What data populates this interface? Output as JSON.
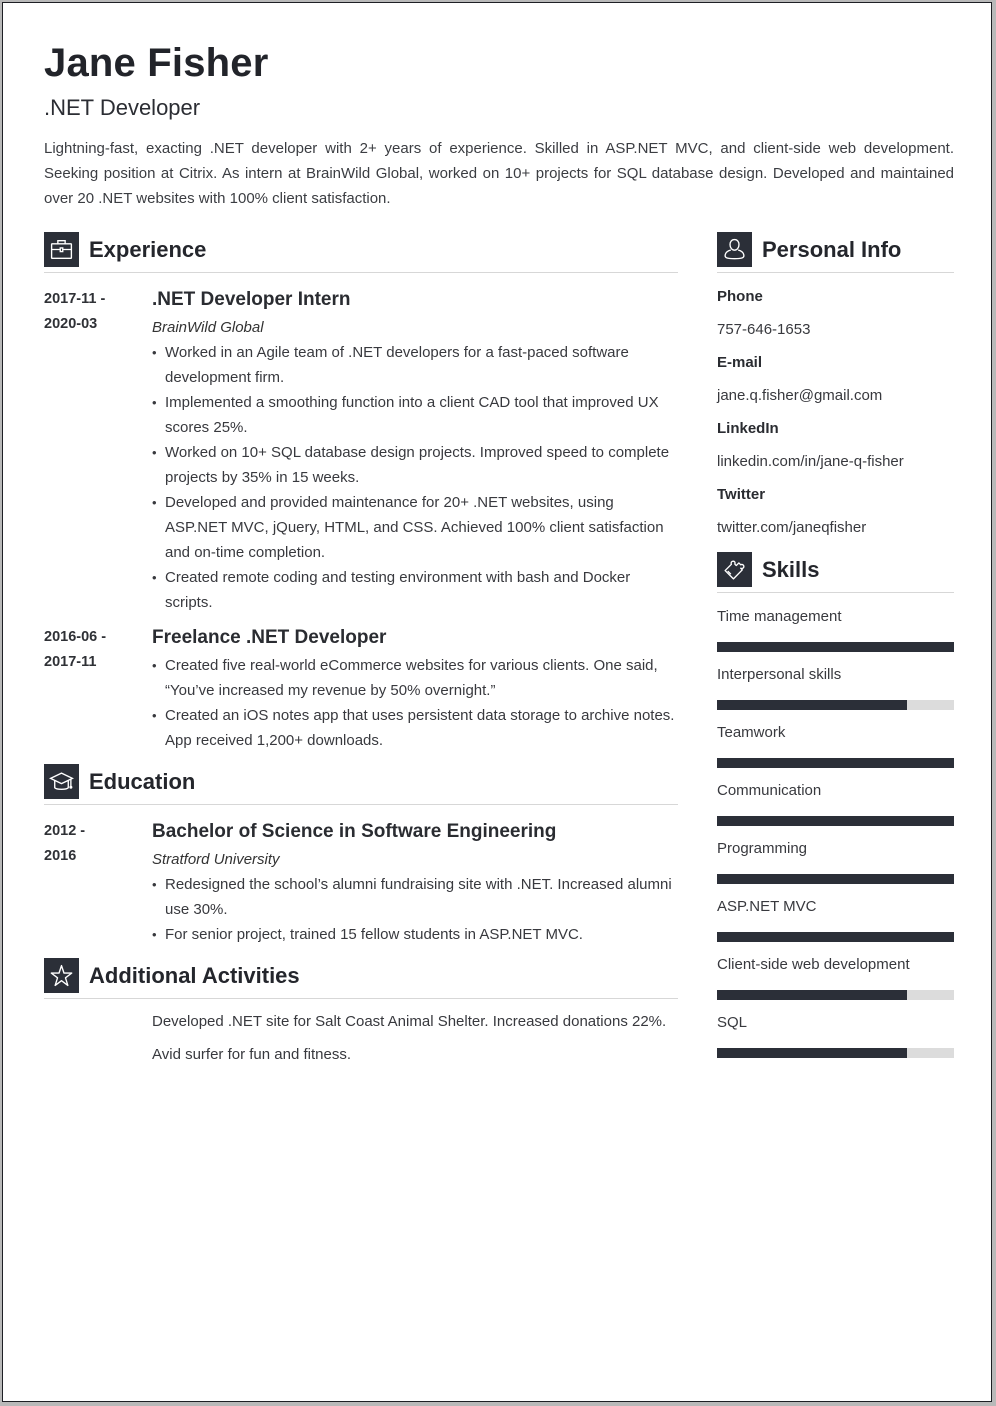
{
  "header": {
    "name": "Jane Fisher",
    "title": ".NET Developer",
    "summary": "Lightning-fast, exacting .NET developer with 2+ years of experience. Skilled in ASP.NET MVC, and client-side web development. Seeking position at Citrix. As intern at BrainWild Global, worked on 10+ projects for SQL database design. Developed and maintained over 20 .NET websites with 100% client satisfaction."
  },
  "experience": {
    "heading": "Experience",
    "icon": "briefcase-icon",
    "entries": [
      {
        "date_start": "2017-11 -",
        "date_end": "2020-03",
        "role": ".NET Developer Intern",
        "company": "BrainWild Global",
        "bullets": [
          "Worked in an Agile team of .NET developers for a fast-paced software development firm.",
          "Implemented a smoothing function into a client CAD tool that improved UX scores 25%.",
          "Worked on 10+ SQL database design projects. Improved speed to complete projects by 35% in 15 weeks.",
          "Developed and provided maintenance for 20+ .NET websites, using ASP.NET MVC, jQuery, HTML, and CSS. Achieved 100% client satisfaction and on-time completion.",
          "Created remote coding and testing environment with bash and Docker scripts."
        ]
      },
      {
        "date_start": "2016-06 -",
        "date_end": "2017-11",
        "role": "Freelance .NET Developer",
        "bullets": [
          "Created five real-world eCommerce websites for various clients. One said, “You’ve increased my revenue by 50% overnight.”",
          "Created an iOS notes app that uses persistent data storage to archive notes. App received 1,200+ downloads."
        ]
      }
    ]
  },
  "education": {
    "heading": "Education",
    "icon": "graduation-cap-icon",
    "entries": [
      {
        "date_start": "2012 -",
        "date_end": "2016",
        "degree": "Bachelor of Science in Software Engineering",
        "school": "Stratford University",
        "bullets": [
          "Redesigned the school’s alumni fundraising site with .NET. Increased alumni use 30%.",
          "For senior project, trained 15 fellow students in ASP.NET MVC."
        ]
      }
    ]
  },
  "activities": {
    "heading": "Additional Activities",
    "icon": "star-icon",
    "items": [
      "Developed .NET site for Salt Coast Animal Shelter. Increased donations 22%.",
      "Avid surfer for fun and fitness."
    ]
  },
  "personal_info": {
    "heading": "Personal Info",
    "icon": "person-icon",
    "items": [
      {
        "label": "Phone",
        "value": "757-646-1653"
      },
      {
        "label": "E-mail",
        "value": "jane.q.fisher@gmail.com"
      },
      {
        "label": "LinkedIn",
        "value": "linkedin.com/in/jane-q-fisher"
      },
      {
        "label": "Twitter",
        "value": "twitter.com/janeqfisher"
      }
    ]
  },
  "skills": {
    "heading": "Skills",
    "icon": "puzzle-icon",
    "items": [
      {
        "name": "Time management",
        "level": 1.0
      },
      {
        "name": "Interpersonal skills",
        "level": 0.8
      },
      {
        "name": "Teamwork",
        "level": 1.0
      },
      {
        "name": "Communication",
        "level": 1.0
      },
      {
        "name": "Programming",
        "level": 1.0
      },
      {
        "name": "ASP.NET MVC",
        "level": 1.0
      },
      {
        "name": "Client-side web development",
        "level": 0.8
      },
      {
        "name": "SQL",
        "level": 0.8
      }
    ]
  },
  "colors": {
    "accent": "#2b2f38",
    "bar_track": "#dcdcdc"
  }
}
